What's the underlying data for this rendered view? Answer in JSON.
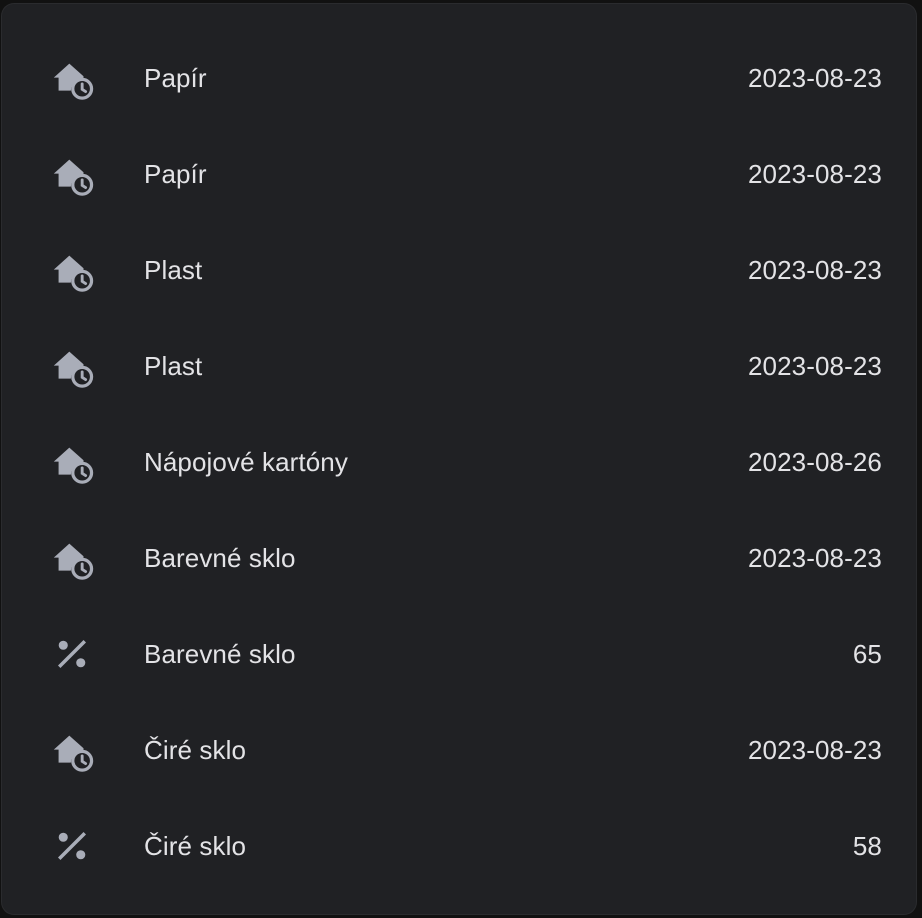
{
  "colors": {
    "card_background": "#202124",
    "text": "#e3e3e6",
    "icon": "#a9adb8"
  },
  "entities": [
    {
      "icon": "home-clock-icon",
      "name": "Papír",
      "value": "2023-08-23"
    },
    {
      "icon": "home-clock-icon",
      "name": "Papír",
      "value": "2023-08-23"
    },
    {
      "icon": "home-clock-icon",
      "name": "Plast",
      "value": "2023-08-23"
    },
    {
      "icon": "home-clock-icon",
      "name": "Plast",
      "value": "2023-08-23"
    },
    {
      "icon": "home-clock-icon",
      "name": "Nápojové kartóny",
      "value": "2023-08-26"
    },
    {
      "icon": "home-clock-icon",
      "name": "Barevné sklo",
      "value": "2023-08-23"
    },
    {
      "icon": "percent-icon",
      "name": "Barevné sklo",
      "value": "65"
    },
    {
      "icon": "home-clock-icon",
      "name": "Čiré sklo",
      "value": "2023-08-23"
    },
    {
      "icon": "percent-icon",
      "name": "Čiré sklo",
      "value": "58"
    }
  ]
}
